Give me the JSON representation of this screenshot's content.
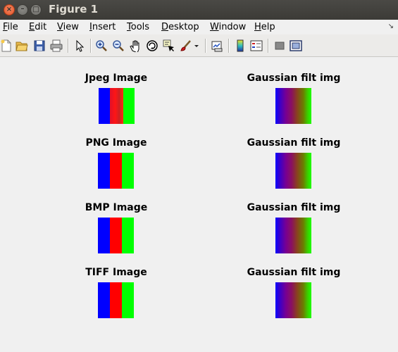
{
  "window": {
    "title": "Figure 1"
  },
  "menubar": {
    "items": [
      {
        "label": "File",
        "u": "F",
        "rest": "ile"
      },
      {
        "label": "Edit",
        "u": "E",
        "rest": "dit"
      },
      {
        "label": "View",
        "u": "V",
        "rest": "iew"
      },
      {
        "label": "Insert",
        "u": "I",
        "rest": "nsert"
      },
      {
        "label": "Tools",
        "u": "T",
        "rest": "ools"
      },
      {
        "label": "Desktop",
        "u": "D",
        "rest": "esktop"
      },
      {
        "label": "Window",
        "u": "W",
        "rest": "indow"
      },
      {
        "label": "Help",
        "u": "H",
        "rest": "elp"
      }
    ]
  },
  "toolbar": {
    "icons": [
      "new-figure-icon",
      "open-file-icon",
      "save-icon",
      "print-icon",
      "edit-plot-arrow-icon",
      "zoom-in-icon",
      "zoom-out-icon",
      "pan-hand-icon",
      "rotate-3d-icon",
      "data-cursor-icon",
      "brush-icon",
      "brush-dropdown-icon",
      "link-plot-icon",
      "insert-colorbar-icon",
      "insert-legend-icon",
      "hide-plot-tools-icon",
      "show-plot-tools-icon"
    ]
  },
  "plots": {
    "titles": [
      "Jpeg Image",
      "Gaussian filt img",
      "PNG Image",
      "Gaussian filt img",
      "BMP Image",
      "Gaussian filt img",
      "TIFF Image",
      "Gaussian filt img"
    ]
  },
  "colors": {
    "blue": "#0000ff",
    "red": "#ff0000",
    "green": "#00ff00",
    "titlebar": "#3c3b37"
  }
}
